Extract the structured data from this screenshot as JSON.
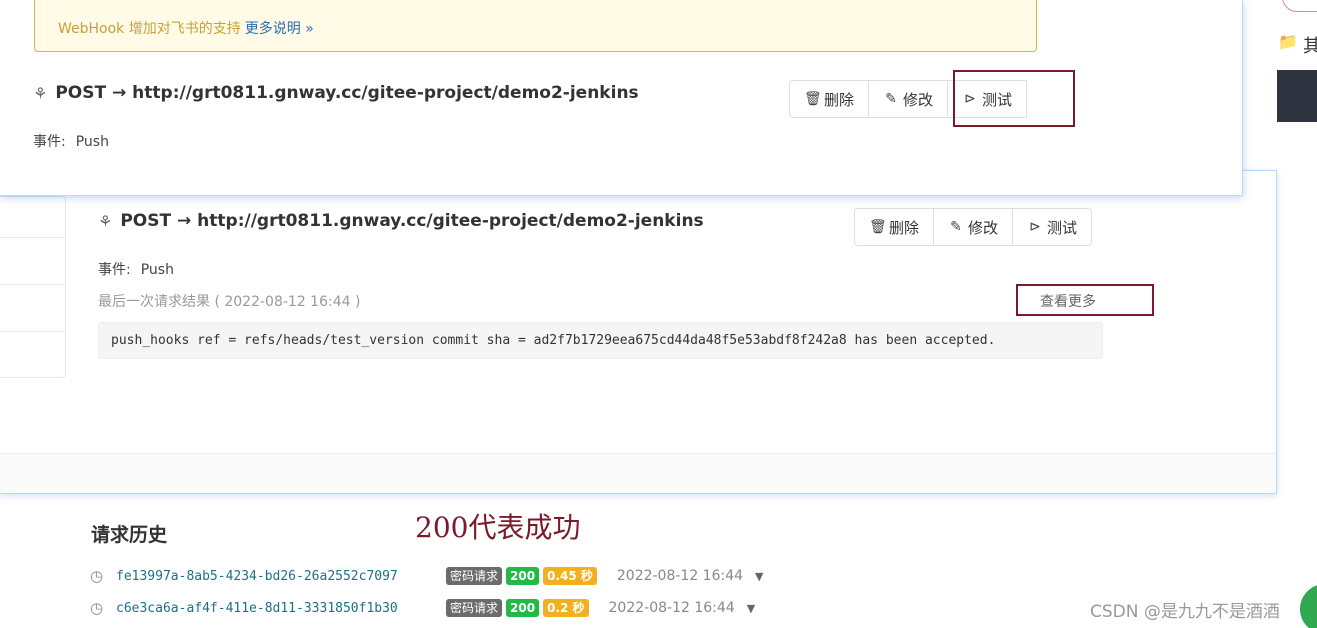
{
  "notice": {
    "text": "WebHook 增加对飞书的支持",
    "link": "更多说明 »"
  },
  "front_hook": {
    "title": "POST → http://grt0811.gnway.cc/gitee-project/demo2-jenkins",
    "event_label": "事件:",
    "event_value": "Push",
    "buttons": {
      "delete": "删除",
      "edit": "修改",
      "test": "测试"
    }
  },
  "back_hook": {
    "title": "POST → http://grt0811.gnway.cc/gitee-project/demo2-jenkins",
    "event_label": "事件:",
    "event_value": "Push",
    "buttons": {
      "delete": "删除",
      "edit": "修改",
      "test": "测试"
    },
    "last_result": "最后一次请求结果 ( 2022-08-12 16:44 )",
    "view_more": "查看更多",
    "response": "push_hooks ref = refs/heads/test_version commit sha = ad2f7b1729eea675cd44da48f5e53abdf8f242a8 has been accepted."
  },
  "history": {
    "title": "请求历史",
    "annotation": "200代表成功",
    "rows": [
      {
        "id": "fe13997a-8ab5-4234-bd26-26a2552c7097",
        "type": "密码请求",
        "status": "200",
        "duration": "0.45 秒",
        "time": "2022-08-12 16:44"
      },
      {
        "id": "c6e3ca6a-af4f-411e-8d11-3331850f1b30",
        "type": "密码请求",
        "status": "200",
        "duration": "0.2 秒",
        "time": "2022-08-12 16:44"
      }
    ]
  },
  "edge": {
    "char": "其"
  },
  "watermark": "CSDN @是九九不是酒酒",
  "icons": {
    "webhook": "webhook-icon",
    "delete": "trash-icon",
    "edit": "edit-icon",
    "test": "terminal-icon",
    "history": "clock-history-icon",
    "expand": "caret-down-icon",
    "folder": "folder-icon"
  },
  "colors": {
    "accent_border": "#bcd8f3",
    "annotation": "#7a1a2a",
    "status_ok": "#21ba45",
    "duration": "#f2b01e",
    "notice_bg": "#fffbe6"
  }
}
